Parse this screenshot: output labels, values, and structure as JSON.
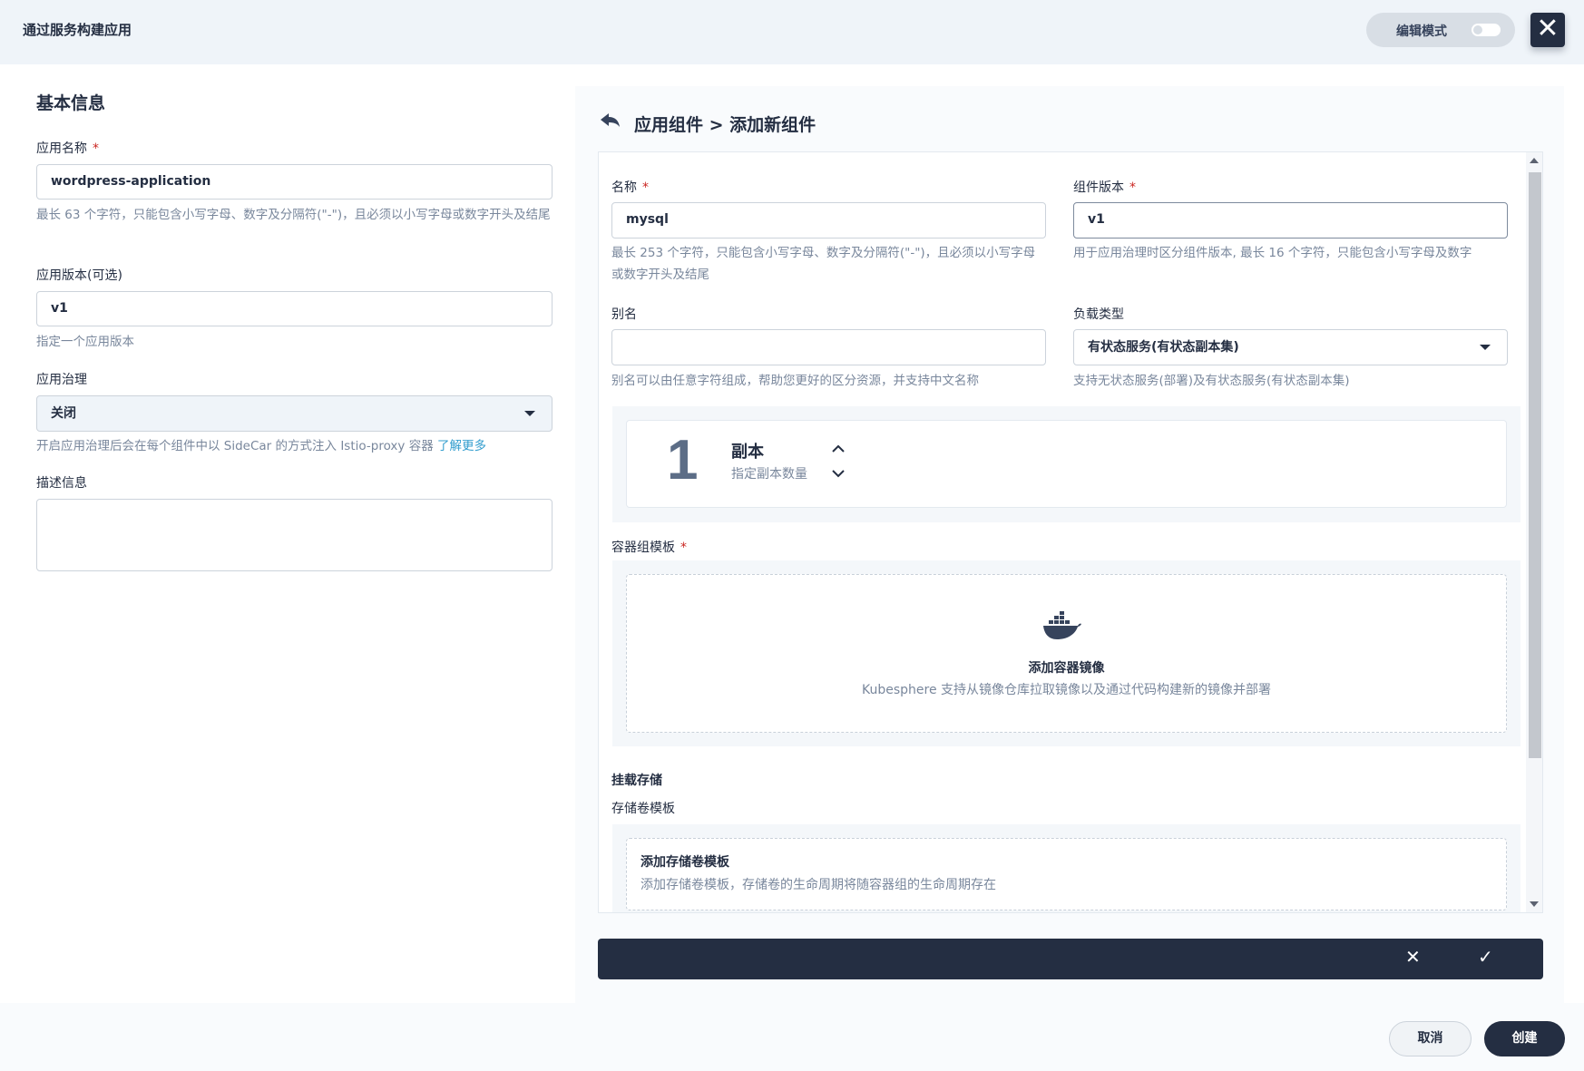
{
  "header": {
    "title": "通过服务构建应用",
    "edit_mode_label": "编辑模式",
    "close_symbol": "✕"
  },
  "basic_info": {
    "section_title": "基本信息",
    "app_name_label": "应用名称",
    "app_name_value": "wordpress-application",
    "app_name_help": "最长 63 个字符，只能包含小写字母、数字及分隔符(\"-\")，且必须以小写字母或数字开头及结尾",
    "app_version_label": "应用版本(可选)",
    "app_version_value": "v1",
    "app_version_help": "指定一个应用版本",
    "governance_label": "应用治理",
    "governance_value": "关闭",
    "governance_help": "开启应用治理后会在每个组件中以 SideCar 的方式注入 Istio-proxy 容器",
    "governance_link": "了解更多",
    "description_label": "描述信息"
  },
  "component": {
    "breadcrumb": "应用组件 > 添加新组件",
    "name_label": "名称",
    "name_value": "mysql",
    "name_help": "最长 253 个字符，只能包含小写字母、数字及分隔符(\"-\")，且必须以小写字母或数字开头及结尾",
    "version_label": "组件版本",
    "version_value": "v1",
    "version_help": "用于应用治理时区分组件版本, 最长 16 个字符，只能包含小写字母及数字",
    "alias_label": "别名",
    "alias_value": "",
    "alias_help": "别名可以由任意字符组成，帮助您更好的区分资源，并支持中文名称",
    "workload_label": "负载类型",
    "workload_value": "有状态服务(有状态副本集)",
    "workload_help": "支持无状态服务(部署)及有状态服务(有状态副本集)",
    "replicas": {
      "count": "1",
      "title": "副本",
      "subtitle": "指定副本数量"
    },
    "container_template_label": "容器组模板",
    "add_container_title": "添加容器镜像",
    "add_container_desc": "Kubesphere 支持从镜像仓库拉取镜像以及通过代码构建新的镜像并部署",
    "mount_storage_label": "挂载存储",
    "volume_template_label": "存储卷模板",
    "add_volume_title": "添加存储卷模板",
    "add_volume_desc": "添加存储卷模板，存储卷的生命周期将随容器组的生命周期存在",
    "required_mark": "*"
  },
  "action_bar": {
    "cancel_symbol": "✕",
    "confirm_symbol": "✓"
  },
  "footer": {
    "cancel_label": "取消",
    "create_label": "创建"
  },
  "colors": {
    "header_bg": "#eff4f9",
    "dark": "#242e42",
    "required": "#ca2621",
    "link": "#329dce",
    "help_text": "#79879c"
  }
}
